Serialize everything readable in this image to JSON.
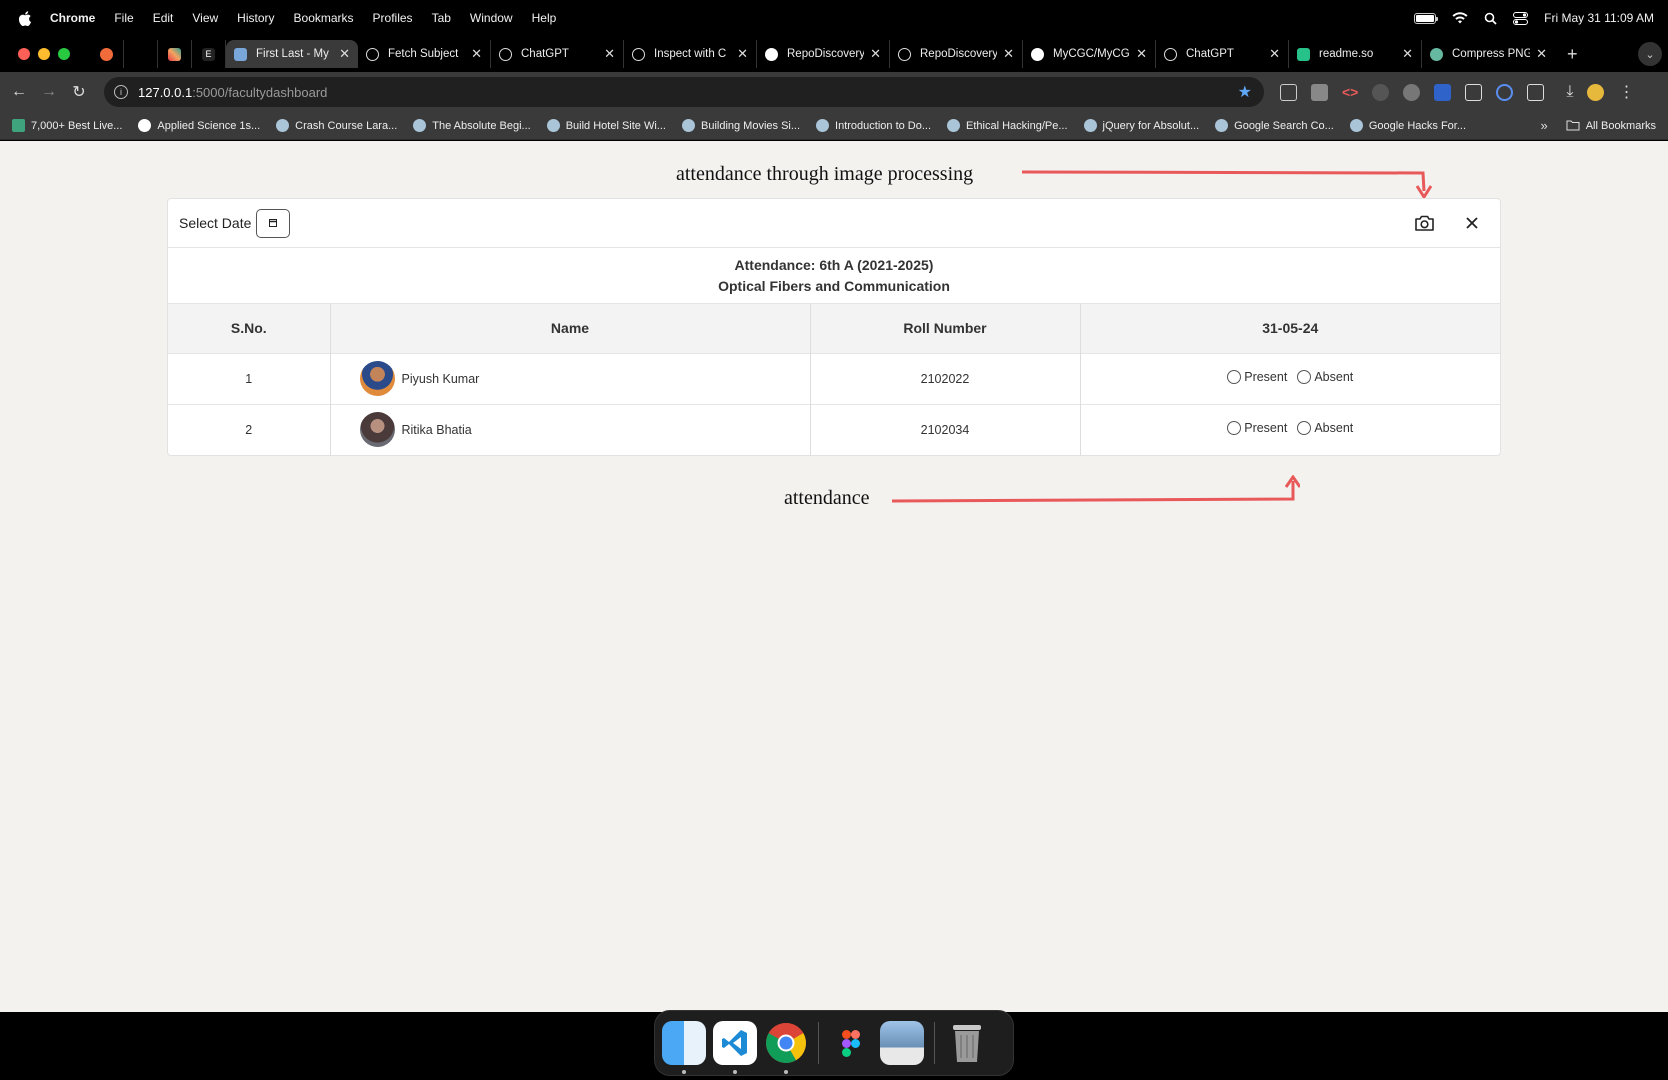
{
  "menubar": {
    "app_name": "Chrome",
    "items": [
      "File",
      "Edit",
      "View",
      "History",
      "Bookmarks",
      "Profiles",
      "Tab",
      "Window",
      "Help"
    ],
    "datetime": "Fri May 31  11:09 AM"
  },
  "tabs": [
    {
      "title": "First Last - My",
      "active": true
    },
    {
      "title": "Fetch Subject",
      "active": false
    },
    {
      "title": "ChatGPT",
      "active": false
    },
    {
      "title": "Inspect with C",
      "active": false
    },
    {
      "title": "RepoDiscovery",
      "active": false
    },
    {
      "title": "RepoDiscovery",
      "active": false
    },
    {
      "title": "MyCGC/MyCG",
      "active": false
    },
    {
      "title": "ChatGPT",
      "active": false
    },
    {
      "title": "readme.so",
      "active": false
    },
    {
      "title": "Compress PNG",
      "active": false
    }
  ],
  "address": {
    "host": "127.0.0.1",
    "path": ":5000/facultydashboard"
  },
  "bookmarks": [
    "7,000+ Best Live...",
    "Applied Science 1s...",
    "Crash Course Lara...",
    "The Absolute Begi...",
    "Build Hotel Site Wi...",
    "Building Movies Si...",
    "Introduction to Do...",
    "Ethical Hacking/Pe...",
    "jQuery for Absolut...",
    "Google Search Co...",
    "Google Hacks For..."
  ],
  "bookmarks_all": "All Bookmarks",
  "annotations": {
    "top": "attendance through image processing",
    "bottom": "attendance"
  },
  "card": {
    "select_date_label": "Select Date",
    "title_line1": "Attendance: 6th A (2021-2025)",
    "title_line2": "Optical Fibers and Communication",
    "columns": [
      "S.No.",
      "Name",
      "Roll Number",
      "31-05-24"
    ],
    "present_label": "Present",
    "absent_label": "Absent",
    "rows": [
      {
        "sno": "1",
        "name": "Piyush Kumar",
        "roll": "2102022"
      },
      {
        "sno": "2",
        "name": "Ritika Bhatia",
        "roll": "2102034"
      }
    ]
  },
  "colors": {
    "annotation_arrow": "#e85a5a",
    "accent_star": "#5ea8f5"
  }
}
